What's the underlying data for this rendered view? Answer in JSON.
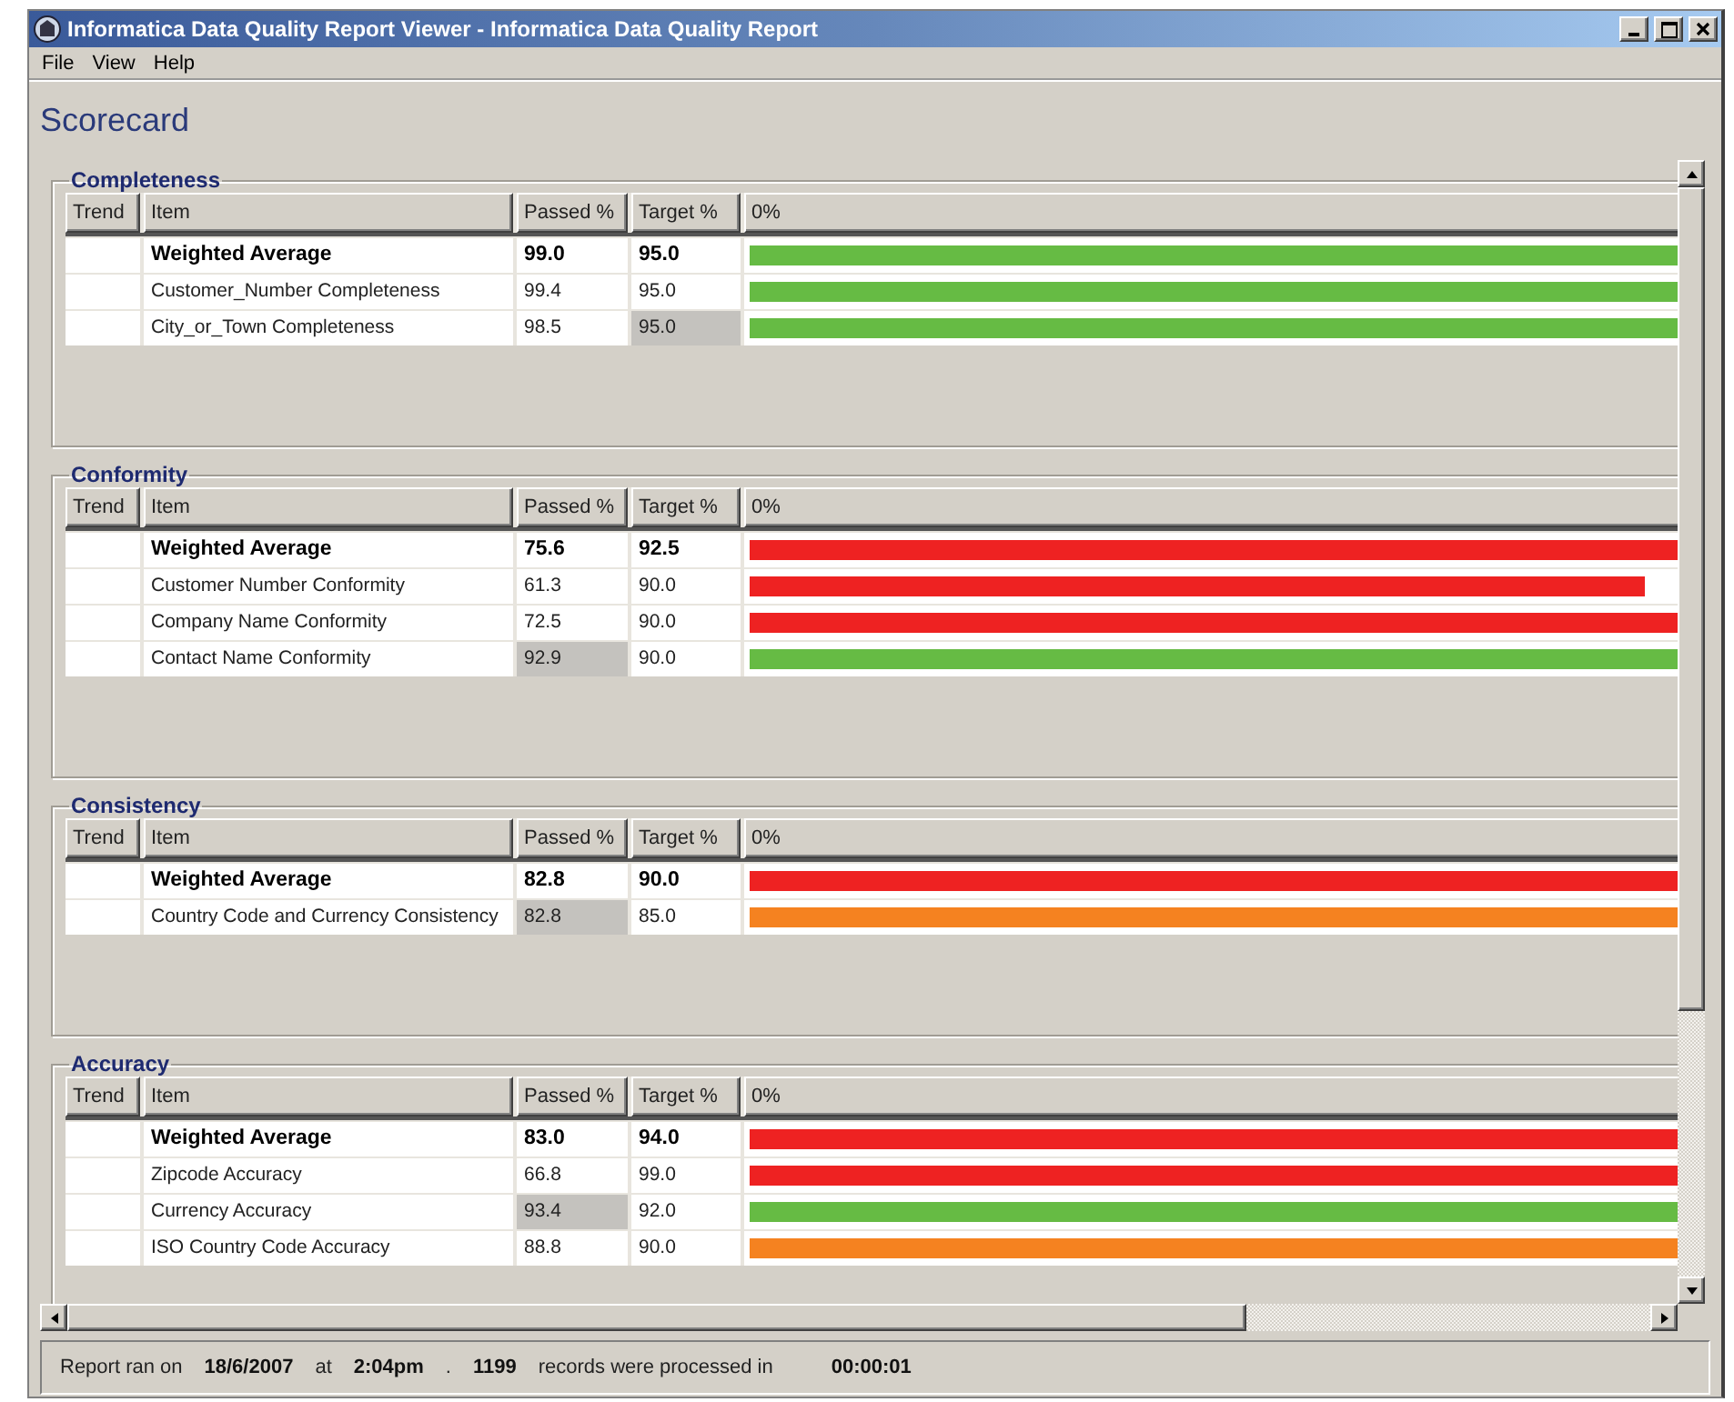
{
  "window": {
    "title": "Informatica Data Quality Report Viewer - Informatica Data Quality Report"
  },
  "menu": [
    "File",
    "View",
    "Help"
  ],
  "heading": "Scorecard",
  "sections": [
    {
      "title": "Completeness",
      "columns": [
        "Trend",
        "Item",
        "Passed %",
        "Target %",
        "0%"
      ],
      "rows": [
        {
          "kind": "average",
          "item": "Weighted Average",
          "passed": "99.0",
          "target": "95.0",
          "passed_shaded": false,
          "target_shaded": false,
          "level": 1,
          "color": "#66bb44"
        },
        {
          "kind": "item",
          "item": "Customer_Number Completeness",
          "passed": "99.4",
          "target": "95.0",
          "passed_shaded": false,
          "target_shaded": false,
          "level": 1,
          "color": "#66bb44"
        },
        {
          "kind": "item",
          "item": "City_or_Town Completeness",
          "passed": "98.5",
          "target": "95.0",
          "passed_shaded": false,
          "target_shaded": true,
          "level": 1,
          "color": "#66bb44"
        }
      ]
    },
    {
      "title": "Conformity",
      "columns": [
        "Trend",
        "Item",
        "Passed %",
        "Target %",
        "0%"
      ],
      "rows": [
        {
          "kind": "average",
          "item": "Weighted Average",
          "passed": "75.6",
          "target": "92.5",
          "passed_shaded": false,
          "target_shaded": false,
          "level": 1,
          "color": "#ee2222"
        },
        {
          "kind": "item",
          "item": "Customer Number Conformity",
          "passed": "61.3",
          "target": "90.0",
          "passed_shaded": false,
          "target_shaded": false,
          "level": 0.96,
          "color": "#ee2222"
        },
        {
          "kind": "item",
          "item": "Company Name Conformity",
          "passed": "72.5",
          "target": "90.0",
          "passed_shaded": false,
          "target_shaded": false,
          "level": 1,
          "color": "#ee2222"
        },
        {
          "kind": "item",
          "item": "Contact Name Conformity",
          "passed": "92.9",
          "target": "90.0",
          "passed_shaded": true,
          "target_shaded": false,
          "level": 1,
          "color": "#66bb44"
        }
      ]
    },
    {
      "title": "Consistency",
      "columns": [
        "Trend",
        "Item",
        "Passed %",
        "Target %",
        "0%"
      ],
      "rows": [
        {
          "kind": "average",
          "item": "Weighted Average",
          "passed": "82.8",
          "target": "90.0",
          "passed_shaded": false,
          "target_shaded": false,
          "level": 1,
          "color": "#ee2222"
        },
        {
          "kind": "item",
          "item": "Country Code and Currency Consistency",
          "passed": "82.8",
          "target": "85.0",
          "passed_shaded": true,
          "target_shaded": false,
          "level": 1,
          "color": "#f58220"
        }
      ]
    },
    {
      "title": "Accuracy",
      "columns": [
        "Trend",
        "Item",
        "Passed %",
        "Target %",
        "0%"
      ],
      "rows": [
        {
          "kind": "average",
          "item": "Weighted Average",
          "passed": "83.0",
          "target": "94.0",
          "passed_shaded": false,
          "target_shaded": false,
          "level": 1,
          "color": "#ee2222"
        },
        {
          "kind": "item",
          "item": "Zipcode Accuracy",
          "passed": "66.8",
          "target": "99.0",
          "passed_shaded": false,
          "target_shaded": false,
          "level": 1,
          "color": "#ee2222"
        },
        {
          "kind": "item",
          "item": "Currency Accuracy",
          "passed": "93.4",
          "target": "92.0",
          "passed_shaded": true,
          "target_shaded": false,
          "level": 1,
          "color": "#66bb44"
        },
        {
          "kind": "item",
          "item": "ISO Country Code Accuracy",
          "passed": "88.8",
          "target": "90.0",
          "passed_shaded": false,
          "target_shaded": false,
          "level": 1,
          "color": "#f58220"
        }
      ]
    }
  ],
  "status_bar": [
    {
      "kind": "label",
      "text": "Report ran on"
    },
    {
      "kind": "value",
      "text": "18/6/2007"
    },
    {
      "kind": "label",
      "text": "at"
    },
    {
      "kind": "value",
      "text": "2:04pm"
    },
    {
      "kind": "label",
      "text": "."
    },
    {
      "kind": "value",
      "text": "1199"
    },
    {
      "kind": "label",
      "text": "records were processed in"
    },
    {
      "kind": "value",
      "text": "00:00:01"
    }
  ]
}
